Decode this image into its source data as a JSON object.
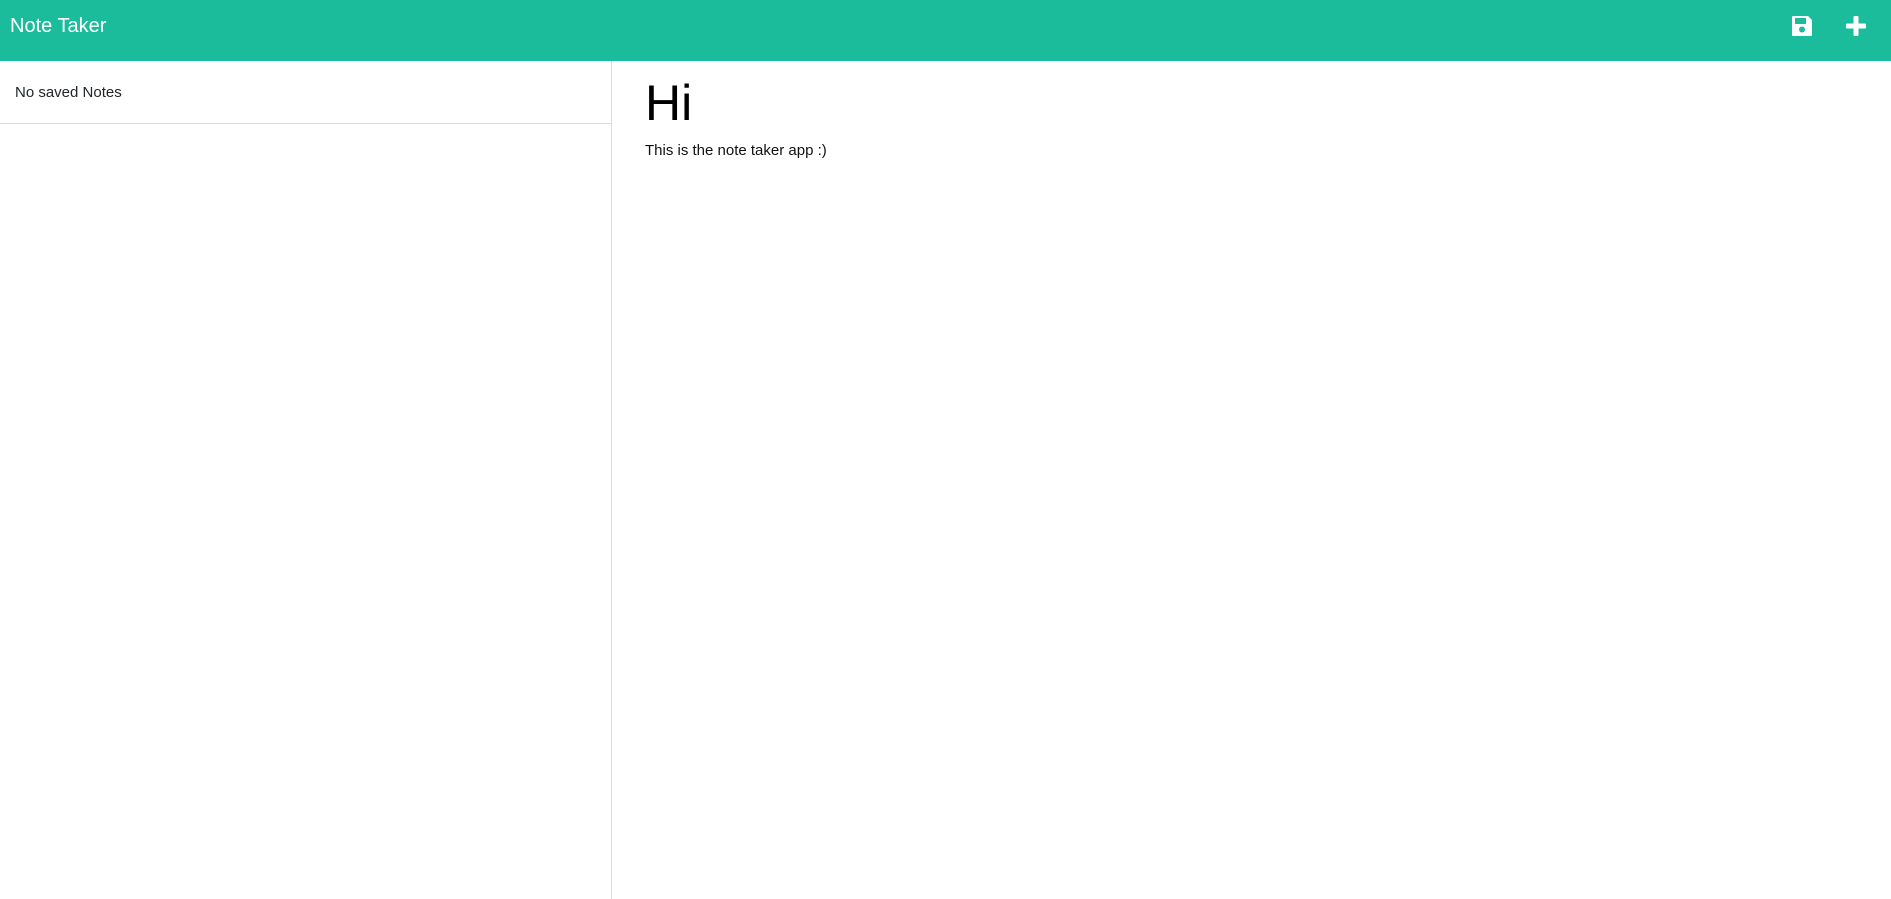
{
  "navbar": {
    "brand": "Note Taker",
    "background": "#1abc9c",
    "save_icon": "save-icon",
    "new_icon": "plus-icon"
  },
  "sidebar": {
    "empty_text": "No saved Notes"
  },
  "editor": {
    "title_value": "Hi",
    "body_value": "This is the note taker app :)"
  }
}
